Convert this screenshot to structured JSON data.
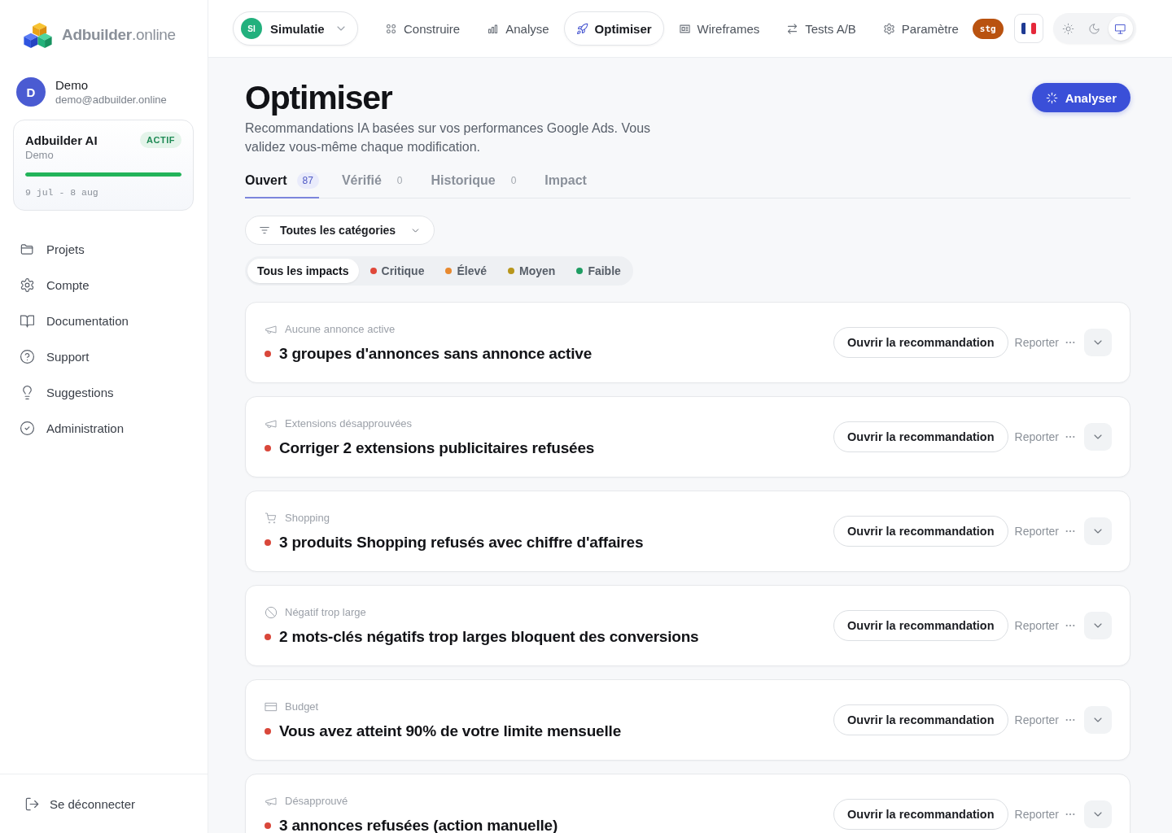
{
  "sidebar": {
    "brand": "**Adbuilder**.online",
    "user": {
      "initial": "D",
      "name": "Demo",
      "email": "demo@adbuilder.online"
    },
    "plan": {
      "name": "Adbuilder AI",
      "status": "ACTIF",
      "account": "Demo",
      "level": 1,
      "period": "9 jul - 8 aug"
    },
    "items": [
      {
        "label": "Projets"
      },
      {
        "label": "Compte"
      },
      {
        "label": "Documentation"
      },
      {
        "label": "Support"
      },
      {
        "label": "Suggestions"
      },
      {
        "label": "Administration"
      }
    ],
    "logout": "Se déconnecter"
  },
  "topbar": {
    "project": {
      "initials": "SI",
      "name": "Simulatie"
    },
    "nav": [
      {
        "label": "Construire",
        "selected": false
      },
      {
        "label": "Analyse",
        "selected": false
      },
      {
        "label": "Optimiser",
        "selected": true
      },
      {
        "label": "Wireframes",
        "selected": false
      },
      {
        "label": "Tests A/B",
        "selected": false
      },
      {
        "label": "Paramètre",
        "selected": false
      }
    ],
    "env_badge": "stg",
    "theme_options": [
      {
        "selected": false
      },
      {
        "selected": false
      },
      {
        "selected": true
      }
    ]
  },
  "page": {
    "title": "Optimiser",
    "description": "Recommandations IA basées sur vos performances Google Ads. Vous validez vous-même chaque modification.",
    "action": "Analyser"
  },
  "tabs": [
    {
      "label": "Ouvert",
      "count": "87",
      "selected": true
    },
    {
      "label": "Vérifié",
      "count": "0",
      "selected": false
    },
    {
      "label": "Historique",
      "count": "0",
      "selected": false
    },
    {
      "label": "Impact",
      "selected": false
    }
  ],
  "filters": {
    "category": "Toutes les catégories",
    "impacts": [
      {
        "label": "Tous les impacts",
        "selected": true
      },
      {
        "label": "Critique",
        "color": "#e0483a",
        "selected": false
      },
      {
        "label": "Élevé",
        "color": "#e8892f",
        "selected": false
      },
      {
        "label": "Moyen",
        "color": "#b8961c",
        "selected": false
      },
      {
        "label": "Faible",
        "color": "#1f9d63",
        "selected": false
      }
    ]
  },
  "recommendations": [
    {
      "category": "Aucune annonce active",
      "title": "3 groupes d'annonces sans annonce active",
      "color": "#d9473a",
      "primary_action": "Ouvrir la recommandation",
      "secondary_action": "Reporter"
    },
    {
      "category": "Extensions désapprouvées",
      "title": "Corriger 2 extensions publicitaires refusées",
      "color": "#d9473a",
      "primary_action": "Ouvrir la recommandation",
      "secondary_action": "Reporter"
    },
    {
      "category": "Shopping",
      "title": "3 produits Shopping refusés avec chiffre d'affaires",
      "color": "#d9473a",
      "primary_action": "Ouvrir la recommandation",
      "secondary_action": "Reporter"
    },
    {
      "category": "Négatif trop large",
      "title": "2 mots-clés négatifs trop larges bloquent des conversions",
      "color": "#d9473a",
      "primary_action": "Ouvrir la recommandation",
      "secondary_action": "Reporter"
    },
    {
      "category": "Budget",
      "title": "Vous avez atteint 90% de votre limite mensuelle",
      "color": "#d9473a",
      "primary_action": "Ouvrir la recommandation",
      "secondary_action": "Reporter"
    },
    {
      "category": "Désapprouvé",
      "title": "3 annonces refusées (action manuelle)",
      "color": "#d9473a",
      "primary_action": "Ouvrir la recommandation",
      "secondary_action": "Reporter"
    }
  ]
}
